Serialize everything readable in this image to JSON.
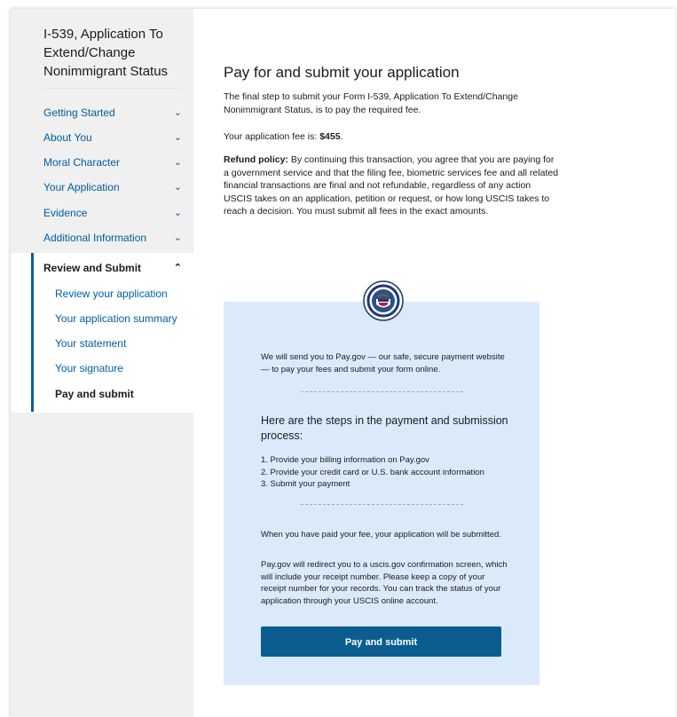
{
  "sidebar": {
    "title": "I-539, Application To Extend/Change Nonimmigrant Status",
    "items": [
      {
        "label": "Getting Started"
      },
      {
        "label": "About You"
      },
      {
        "label": "Moral Character"
      },
      {
        "label": "Your Application"
      },
      {
        "label": "Evidence"
      },
      {
        "label": "Additional Information"
      }
    ],
    "active_section": {
      "label": "Review and Submit",
      "subitems": [
        {
          "label": "Review your application"
        },
        {
          "label": "Your application summary"
        },
        {
          "label": "Your statement"
        },
        {
          "label": "Your signature"
        },
        {
          "label": "Pay and submit"
        }
      ]
    }
  },
  "main": {
    "title": "Pay for and submit your application",
    "intro": "The final step to submit your Form I-539, Application To Extend/Change Nonimmigrant Status, is to pay the required fee.",
    "fee_label": "Your application fee is: ",
    "fee_value": "$455",
    "fee_suffix": ".",
    "refund_label": "Refund policy:",
    "refund_text": " By continuing this transaction, you agree that you are paying for a government service and that the filing fee, biometric services fee and all related financial transactions are final and not refundable, regardless of any action USCIS takes on an application, petition or request, or how long USCIS takes to reach a decision. You must submit all fees in the exact amounts."
  },
  "panel": {
    "intro": "We will send you to Pay.gov — our safe, secure payment website — to pay your fees and submit your form online.",
    "steps_heading": "Here are the steps in the payment and submission process:",
    "steps": [
      "1. Provide your billing information on Pay.gov",
      "2. Provide your credit card or U.S. bank account information",
      "3. Submit your payment"
    ],
    "after_payment": "When you have paid your fee, your application will be submitted.",
    "redirect_text": "Pay.gov will redirect you to a uscis.gov confirmation screen, which will include your receipt number. Please keep a copy of your receipt number for your records. You can track the status of your application through your USCIS online account.",
    "button_label": "Pay and submit"
  },
  "icons": {
    "chevron_down": "chevron-down-icon",
    "chevron_up": "chevron-up-icon",
    "seal": "dhs-seal-icon"
  },
  "colors": {
    "link": "#005ea2",
    "panel_bg": "#dbeafb",
    "button_bg": "#0b5c8f",
    "sidebar_bg": "#f0f0f0"
  }
}
